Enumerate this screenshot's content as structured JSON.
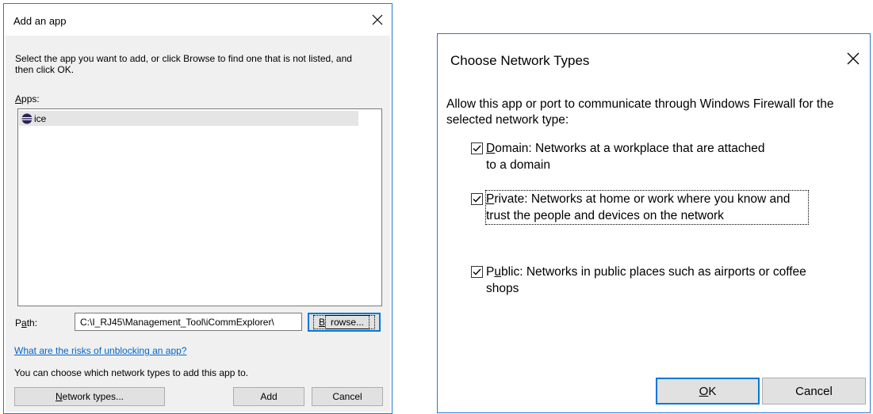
{
  "add_dialog": {
    "title": "Add an app",
    "instructions": "Select the app you want to add, or click Browse to find one that is not listed, and then click OK.",
    "apps_label": "Apps:",
    "apps": [
      {
        "name": "ice",
        "icon": "eclipse-app-icon"
      }
    ],
    "path_label": "Path:",
    "path_value": "C:\\I_RJ45\\Management_Tool\\iCommExplorer\\",
    "browse_label": "Browse...",
    "risks_link": "What are the risks of unblocking an app?",
    "network_info": "You can choose which network types to add this app to.",
    "network_types_label": "Network types...",
    "add_label": "Add",
    "cancel_label": "Cancel"
  },
  "network_dialog": {
    "title": "Choose Network Types",
    "description": "Allow this app or port to communicate through Windows Firewall for the selected network type:",
    "options": [
      {
        "key": "D",
        "rest": "omain: Networks at a workplace that are attached to a domain",
        "checked": true
      },
      {
        "key": "P",
        "rest": "rivate:  Networks at home or work where you know and trust the people and devices on the network",
        "checked": true
      },
      {
        "key": "u",
        "prefix": "P",
        "rest": "blic:  Networks in public places such as airports or coffee shops",
        "checked": true
      }
    ],
    "ok_key": "O",
    "ok_rest": "K",
    "cancel_label": "Cancel"
  },
  "colors": {
    "accent": "#0078d7",
    "dialog_border": "#2b78d4",
    "panel_bg": "#f0f0f0",
    "link": "#0066cc"
  }
}
